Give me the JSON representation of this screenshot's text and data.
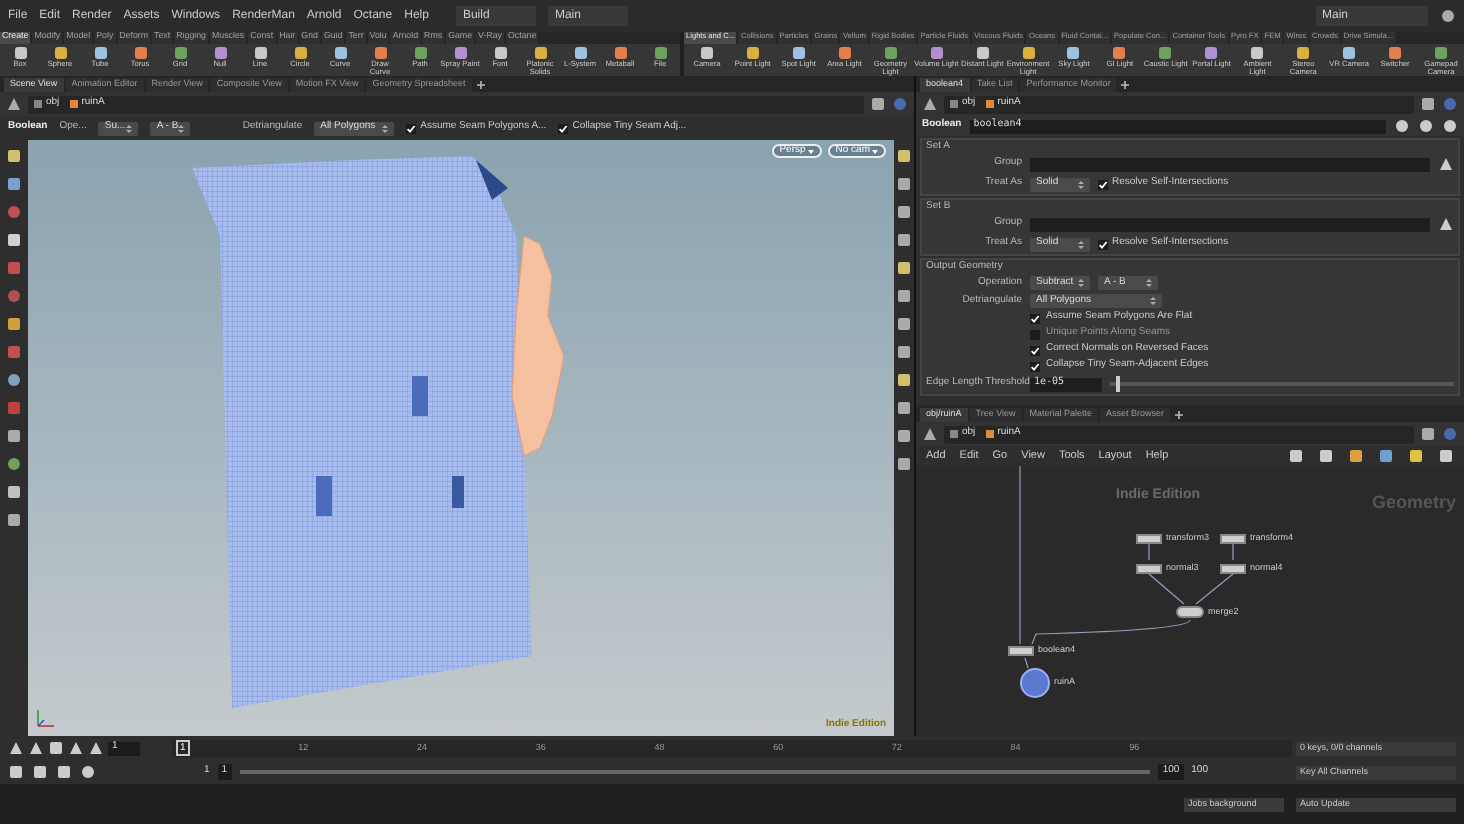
{
  "menu_bar": {
    "items": [
      "File",
      "Edit",
      "Render",
      "Assets",
      "Windows",
      "RenderMan",
      "Arnold",
      "Octane",
      "Help"
    ],
    "desktop": "Build",
    "context": "Main",
    "context_right": "Main"
  },
  "shelf_left": {
    "tabs": [
      {
        "label": "Create",
        "selected": true
      },
      {
        "label": "Modify",
        "selected": false
      },
      {
        "label": "Model",
        "selected": false
      },
      {
        "label": "Poly",
        "selected": false
      },
      {
        "label": "Deform",
        "selected": false
      },
      {
        "label": "Text",
        "selected": false
      },
      {
        "label": "Rigging",
        "selected": false
      },
      {
        "label": "Muscles",
        "selected": false
      },
      {
        "label": "Const",
        "selected": false
      },
      {
        "label": "Hair",
        "selected": false
      },
      {
        "label": "Grid",
        "selected": false
      },
      {
        "label": "Guid",
        "selected": false
      },
      {
        "label": "Terr",
        "selected": false
      },
      {
        "label": "Volu",
        "selected": false
      },
      {
        "label": "Arnold",
        "selected": false
      },
      {
        "label": "Rms",
        "selected": false
      },
      {
        "label": "Game",
        "selected": false
      },
      {
        "label": "V-Ray",
        "selected": false
      },
      {
        "label": "Octane",
        "selected": false
      }
    ],
    "tools": [
      "Box",
      "Sphere",
      "Tube",
      "Torus",
      "Grid",
      "Null",
      "Line",
      "Circle",
      "Curve",
      "Draw Curve",
      "Path",
      "Spray Paint",
      "Font",
      "Platonic Solids",
      "L-System",
      "Metaball",
      "File"
    ]
  },
  "shelf_right": {
    "tabs": [
      {
        "label": "Lights and C...",
        "selected": true
      },
      {
        "label": "Collisions",
        "selected": false
      },
      {
        "label": "Particles",
        "selected": false
      },
      {
        "label": "Grains",
        "selected": false
      },
      {
        "label": "Vellum",
        "selected": false
      },
      {
        "label": "Rigid Bodies",
        "selected": false
      },
      {
        "label": "Particle Fluids",
        "selected": false
      },
      {
        "label": "Viscous Fluids",
        "selected": false
      },
      {
        "label": "Oceans",
        "selected": false
      },
      {
        "label": "Fluid Contai...",
        "selected": false
      },
      {
        "label": "Populate Con...",
        "selected": false
      },
      {
        "label": "Container Tools",
        "selected": false
      },
      {
        "label": "Pyro FX",
        "selected": false
      },
      {
        "label": "FEM",
        "selected": false
      },
      {
        "label": "Wires",
        "selected": false
      },
      {
        "label": "Crowds",
        "selected": false
      },
      {
        "label": "Drive Simula...",
        "selected": false
      }
    ],
    "tools": [
      "Camera",
      "Point Light",
      "Spot Light",
      "Area Light",
      "Geometry Light",
      "Volume Light",
      "Distant Light",
      "Environment Light",
      "Sky Light",
      "GI Light",
      "Caustic Light",
      "Portal Light",
      "Ambient Light",
      "Stereo Camera",
      "VR Camera",
      "Switcher",
      "Gamepad Camera"
    ]
  },
  "scene_pane": {
    "tabs": [
      {
        "label": "Scene View",
        "selected": true
      },
      {
        "label": "Animation Editor",
        "selected": false
      },
      {
        "label": "Render View",
        "selected": false
      },
      {
        "label": "Composite View",
        "selected": false
      },
      {
        "label": "Motion FX View",
        "selected": false
      },
      {
        "label": "Geometry Spreadsheet",
        "selected": false
      }
    ],
    "path": [
      "obj",
      "ruinA"
    ],
    "toolbar": {
      "node": "Boolean",
      "operation_label": "Ope...",
      "operation": "Su...",
      "mode": "A - B",
      "detriangulate_label": "Detriangulate",
      "detriangulate": "All Polygons",
      "checks": [
        {
          "label": "Assume Seam Polygons A...",
          "checked": true
        },
        {
          "label": "Collapse Tiny Seam Adj...",
          "checked": true
        }
      ]
    },
    "viewport": {
      "camera": "Persp",
      "cam": "No cam",
      "edition": "Indie Edition"
    }
  },
  "parameter_pane": {
    "tabs": [
      {
        "label": "boolean4",
        "selected": true
      },
      {
        "label": "Take List",
        "selected": false
      },
      {
        "label": "Performance Monitor",
        "selected": false
      }
    ],
    "path": [
      "obj",
      "ruinA"
    ],
    "node_type": "Boolean",
    "node_name": "boolean4",
    "sections": [
      {
        "title": "Set A",
        "rows": [
          {
            "kind": "field",
            "label": "Group"
          },
          {
            "kind": "menu_check",
            "label": "Treat As",
            "value": "Solid",
            "check": "Resolve Self-Intersections",
            "checked": true
          }
        ]
      },
      {
        "title": "Set B",
        "rows": [
          {
            "kind": "field",
            "label": "Group"
          },
          {
            "kind": "menu_check",
            "label": "Treat As",
            "value": "Solid",
            "check": "Resolve Self-Intersections",
            "checked": true
          }
        ]
      },
      {
        "title": "Output Geometry",
        "rows": [
          {
            "kind": "menus",
            "label": "Operation",
            "values": [
              "Subtract",
              "A - B"
            ]
          },
          {
            "kind": "menu",
            "label": "Detriangulate",
            "value": "All Polygons"
          },
          {
            "kind": "check",
            "label": "Assume Seam Polygons Are Flat",
            "checked": true
          },
          {
            "kind": "check",
            "label": "Unique Points Along Seams",
            "checked": false
          },
          {
            "kind": "check",
            "label": "Correct Normals on Reversed Faces",
            "checked": true
          },
          {
            "kind": "check",
            "label": "Collapse Tiny Seam-Adjacent Edges",
            "checked": true
          },
          {
            "kind": "slider",
            "label": "Edge Length Threshold",
            "value": "1e-05",
            "level": 0.02
          }
        ]
      }
    ]
  },
  "network_pane": {
    "tabs": [
      {
        "label": "obj/ruinA",
        "selected": true
      },
      {
        "label": "Tree View",
        "selected": false
      },
      {
        "label": "Material Palette",
        "selected": false
      },
      {
        "label": "Asset Browser",
        "selected": false
      }
    ],
    "path": [
      "obj",
      "ruinA"
    ],
    "menu": [
      "Add",
      "Edit",
      "Go",
      "View",
      "Tools",
      "Layout",
      "Help"
    ],
    "edition": "Indie Edition",
    "context": "Geometry",
    "nodes": [
      {
        "name": "transform3",
        "kind": "box"
      },
      {
        "name": "transform4",
        "kind": "box"
      },
      {
        "name": "normal3",
        "kind": "box"
      },
      {
        "name": "normal4",
        "kind": "box"
      },
      {
        "name": "merge2",
        "kind": "merge"
      },
      {
        "name": "boolean4",
        "kind": "box"
      },
      {
        "name": "ruinA",
        "kind": "object"
      }
    ]
  },
  "timeline": {
    "frame": "1",
    "marker": "1",
    "ticks": [
      "12",
      "24",
      "36",
      "48",
      "60",
      "72",
      "84",
      "96"
    ],
    "start": "1",
    "range_start": "1",
    "range_end": "100",
    "end": "100",
    "keys": "0 keys, 0/0 channels",
    "key_all": "Key All Channels",
    "jobs": "Jobs background",
    "update": "Auto Update"
  }
}
